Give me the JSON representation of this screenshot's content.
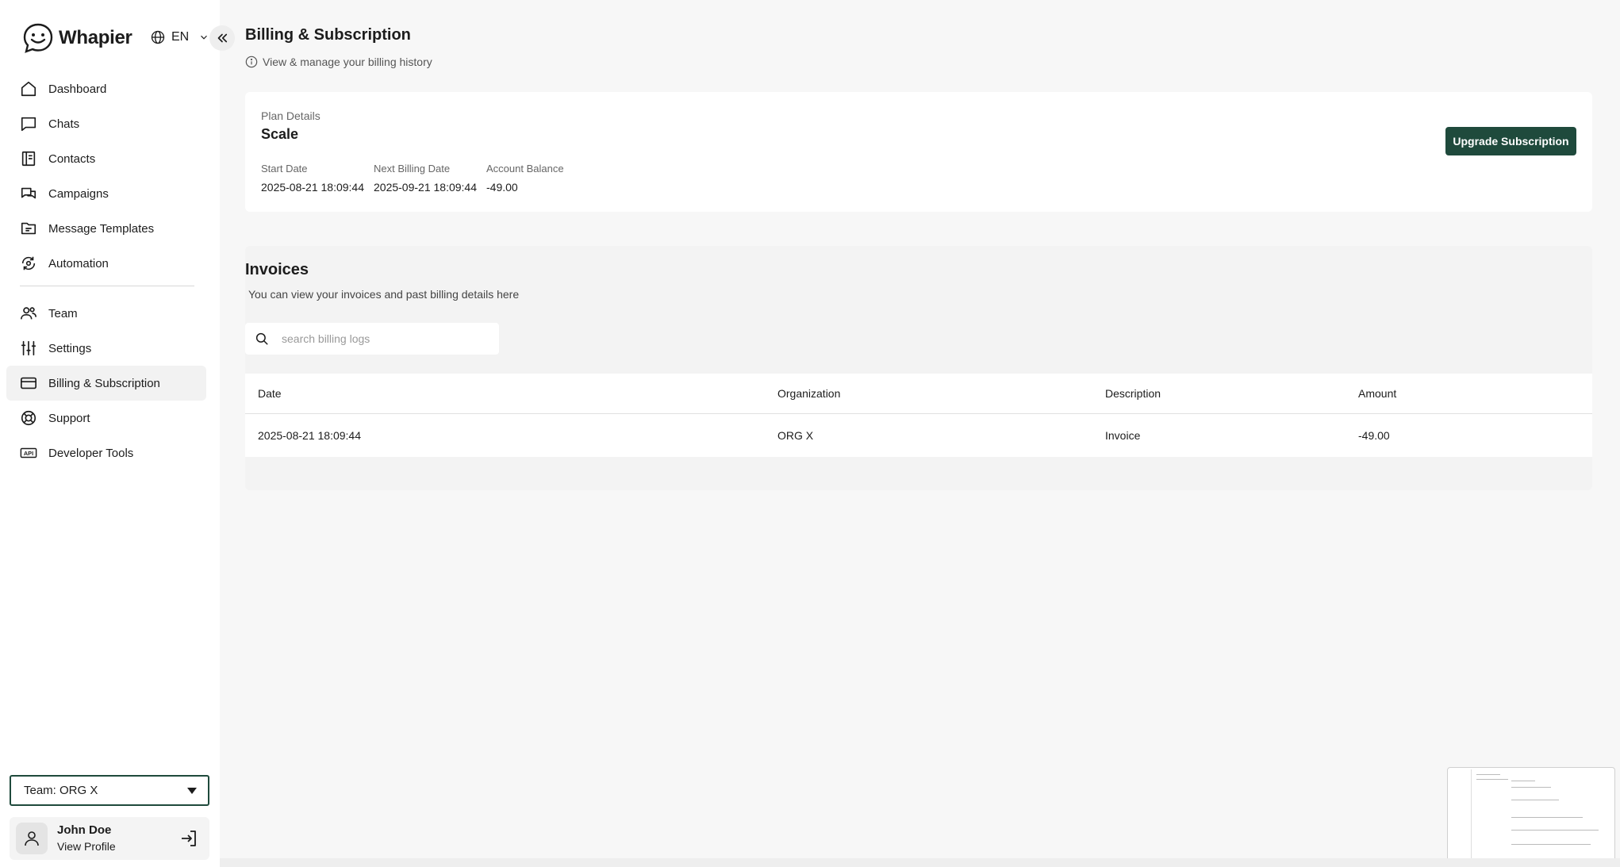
{
  "app": {
    "name": "Whapier",
    "language": "EN"
  },
  "sidebar": {
    "items": [
      {
        "label": "Dashboard",
        "icon": "home-icon"
      },
      {
        "label": "Chats",
        "icon": "chat-bubble-icon"
      },
      {
        "label": "Contacts",
        "icon": "contacts-book-icon"
      },
      {
        "label": "Campaigns",
        "icon": "campaigns-icon"
      },
      {
        "label": "Message Templates",
        "icon": "template-icon"
      },
      {
        "label": "Automation",
        "icon": "automation-icon"
      },
      {
        "label": "Team",
        "icon": "team-icon"
      },
      {
        "label": "Settings",
        "icon": "sliders-icon"
      },
      {
        "label": "Billing & Subscription",
        "icon": "credit-card-icon"
      },
      {
        "label": "Support",
        "icon": "lifebuoy-icon"
      },
      {
        "label": "Developer Tools",
        "icon": "api-icon"
      }
    ],
    "active": "Billing & Subscription",
    "team_select": "Team: ORG X",
    "user": {
      "name": "John Doe",
      "link": "View Profile"
    }
  },
  "header": {
    "title": "Billing & Subscription",
    "subtitle": "View & manage your billing history"
  },
  "plan": {
    "label": "Plan Details",
    "name": "Scale",
    "fields": [
      {
        "label": "Start Date",
        "value": "2025-08-21 18:09:44"
      },
      {
        "label": "Next Billing Date",
        "value": "2025-09-21 18:09:44"
      },
      {
        "label": "Account Balance",
        "value": "-49.00"
      }
    ],
    "upgrade_label": "Upgrade Subscription"
  },
  "invoices": {
    "title": "Invoices",
    "subtitle": "You can view your invoices and past billing details here",
    "search_placeholder": "search billing logs",
    "columns": [
      "Date",
      "Organization",
      "Description",
      "Amount"
    ],
    "rows": [
      [
        "2025-08-21 18:09:44",
        "ORG X",
        "Invoice",
        "-49.00"
      ]
    ]
  },
  "colors": {
    "accent": "#1f4a3c",
    "background": "#f7f7f7",
    "sidebar": "#ffffff"
  }
}
